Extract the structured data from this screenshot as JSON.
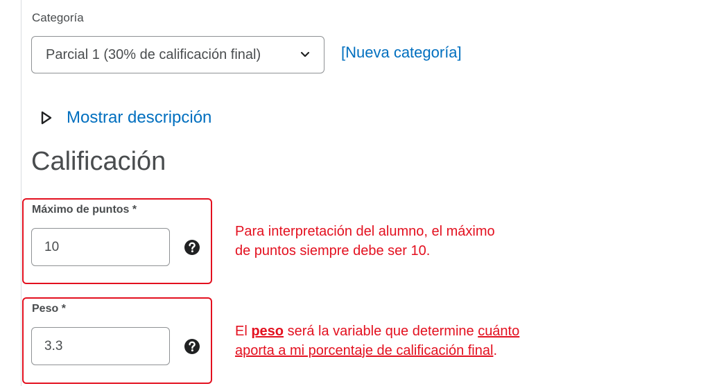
{
  "category": {
    "label": "Categoría",
    "selected": "Parcial 1 (30% de calificación final)",
    "new_link": "[Nueva categoría]"
  },
  "description": {
    "toggle_label": "Mostrar descripción"
  },
  "grading": {
    "title": "Calificación",
    "max_points": {
      "label": "Máximo de puntos *",
      "value": "10"
    },
    "weight": {
      "label": "Peso *",
      "value": "3.3"
    }
  },
  "annotations": {
    "max_points_note": {
      "line1": "Para interpretación del alumno, el máximo",
      "line2": "de puntos siempre debe ser 10."
    },
    "weight_note": {
      "prefix": "El ",
      "bold": "peso",
      "middle": " será la variable que determine ",
      "underline1": "cuánto",
      "underline2": "aporta a mi porcentaje de calificación final",
      "suffix": "."
    }
  },
  "colors": {
    "link": "#006fbf",
    "annotation": "#e3101f",
    "text": "#494c4e"
  }
}
